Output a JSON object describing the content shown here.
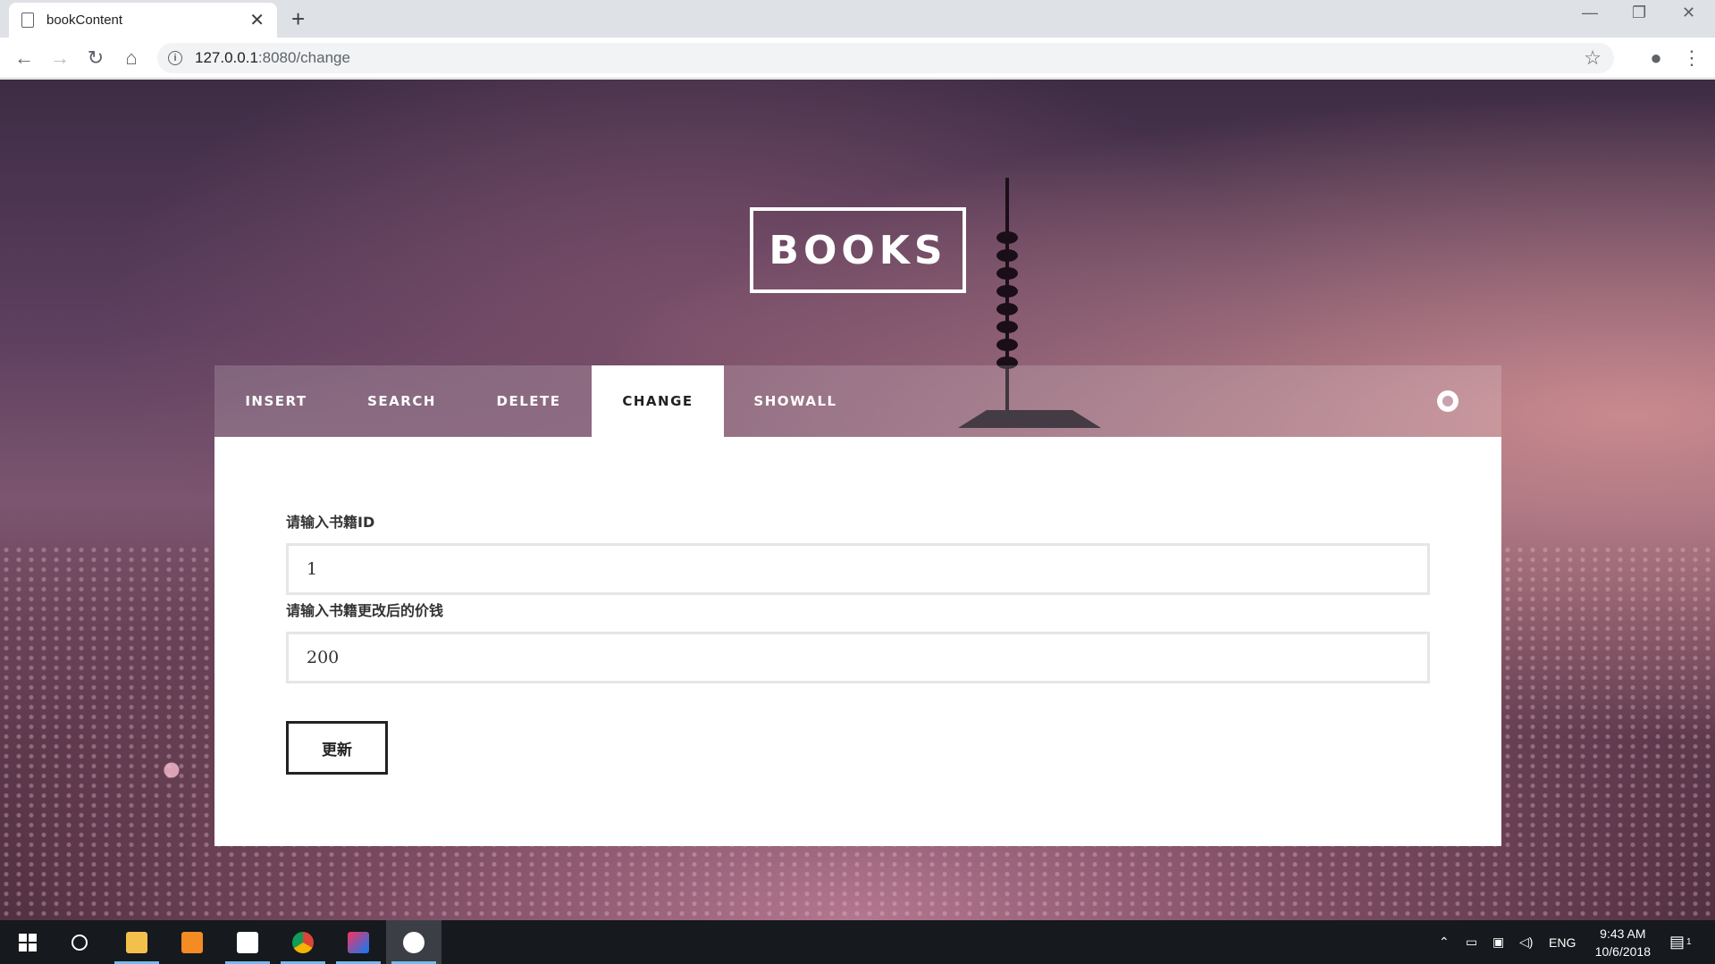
{
  "browser": {
    "tab_title": "bookContent",
    "tab_close": "✕",
    "new_tab": "+",
    "url_host": "127.0.0.1",
    "url_rest": ":8080/change",
    "win_min": "—",
    "win_restore": "❐",
    "win_close": "✕"
  },
  "hero": {
    "logo": "BOOKS"
  },
  "nav": {
    "items": [
      {
        "label": "INSERT"
      },
      {
        "label": "SEARCH"
      },
      {
        "label": "DELETE"
      },
      {
        "label": "CHANGE"
      },
      {
        "label": "SHOWALL"
      }
    ],
    "active": "CHANGE"
  },
  "form": {
    "id_label": "请输入书籍ID",
    "id_value": "1",
    "price_label": "请输入书籍更改后的价钱",
    "price_value": "200",
    "submit_label": "更新"
  },
  "taskbar": {
    "lang": "ENG",
    "time": "9:43 AM",
    "date": "10/6/2018",
    "notifications": "1"
  }
}
